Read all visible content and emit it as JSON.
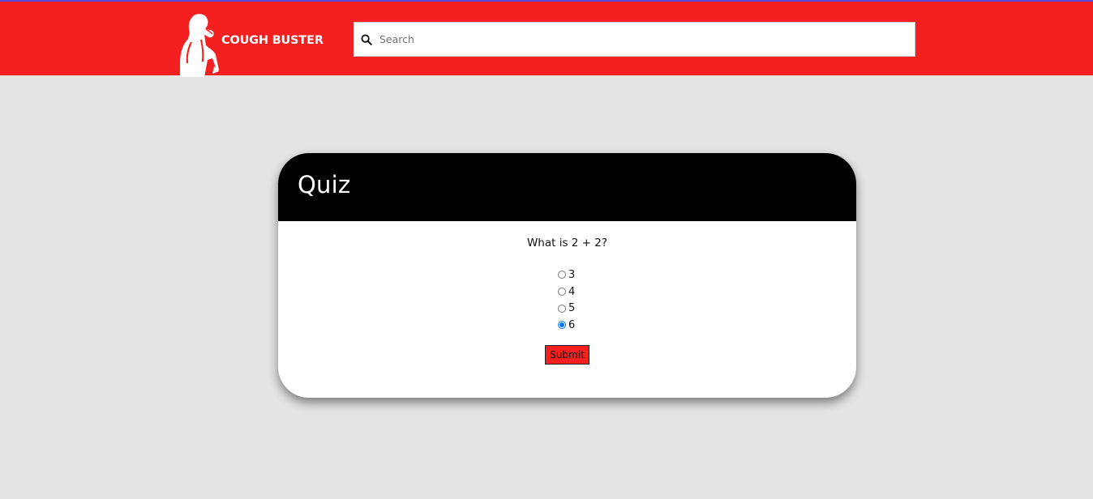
{
  "header": {
    "brand": "COUGH BUSTER",
    "logo_icon": "coughing-man-icon",
    "search_placeholder": "Search",
    "search_value": "",
    "colors": {
      "header_bg": "#f41f1f",
      "accent_line": "#5b4ad6"
    }
  },
  "quiz": {
    "title": "Quiz",
    "question": "What is 2 + 2?",
    "options": [
      "3",
      "4",
      "5",
      "6"
    ],
    "selected": "6",
    "submit_label": "Submit",
    "colors": {
      "title_bar": "#000000",
      "submit_bg": "#f41f1f",
      "page_bg": "#e4e4e4"
    }
  }
}
